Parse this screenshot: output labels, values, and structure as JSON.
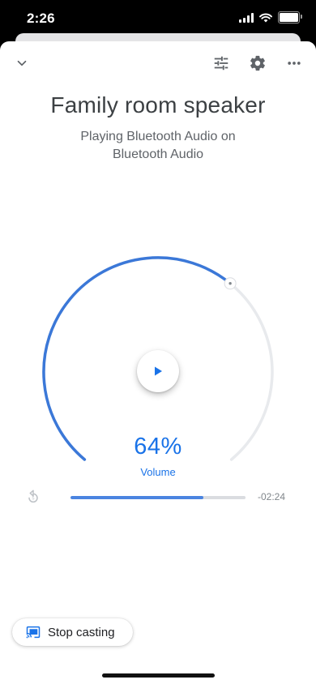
{
  "status_bar": {
    "time": "2:26"
  },
  "header": {
    "collapse_icon": "chevron-down-icon",
    "equalizer_icon": "tune-icon",
    "settings_icon": "gear-icon",
    "more_icon": "more-horizontal-icon"
  },
  "device": {
    "title": "Family room speaker",
    "subtitle": "Playing Bluetooth Audio on Bluetooth Audio"
  },
  "volume": {
    "value_text": "64%",
    "level": 0.64,
    "label": "Volume"
  },
  "playback": {
    "state_icon": "play-icon",
    "progress": 0.76,
    "time_remaining": "-02:24",
    "replay_icon": "replay-icon"
  },
  "footer": {
    "stop_casting_label": "Stop casting",
    "cast_icon": "cast-connected-icon"
  },
  "colors": {
    "accent": "#1a73e8",
    "arc_active": "#3b78d8",
    "arc_inactive": "#e8eaed"
  }
}
